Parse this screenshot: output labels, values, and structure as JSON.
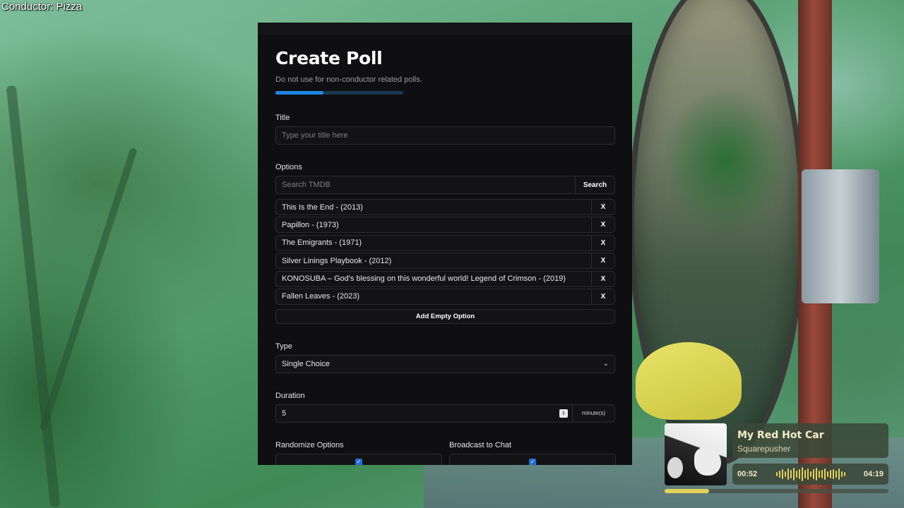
{
  "overlay": {
    "conductor_label": "Conductor: Pizza"
  },
  "poll": {
    "title": "Create Poll",
    "subtitle": "Do not use for non-conductor related polls.",
    "progress_fraction": 0.376,
    "title_field": {
      "label": "Title",
      "placeholder": "Type your title here",
      "value": ""
    },
    "options_section": {
      "label": "Options",
      "search_placeholder": "Search TMDB",
      "search_button": "Search",
      "items": [
        {
          "name": "This Is the End - (2013)",
          "remove": "X"
        },
        {
          "name": "Papillon - (1973)",
          "remove": "X"
        },
        {
          "name": "The Emigrants - (1971)",
          "remove": "X"
        },
        {
          "name": "Silver Linings Playbook - (2012)",
          "remove": "X"
        },
        {
          "name": "KONOSUBA – God's blessing on this wonderful world! Legend of Crimson - (2019)",
          "remove": "X"
        },
        {
          "name": "Fallen Leaves - (2023)",
          "remove": "X"
        }
      ],
      "add_empty_button": "Add Empty Option"
    },
    "type_field": {
      "label": "Type",
      "selected": "Single Choice"
    },
    "duration_field": {
      "label": "Duration",
      "value": "5",
      "unit": "minute(s)"
    },
    "randomize": {
      "label": "Randomize Options",
      "checked": true
    },
    "broadcast": {
      "label": "Broadcast to Chat",
      "checked": true
    },
    "accent_color": "#1e88e5"
  },
  "music": {
    "song": "My Red Hot Car",
    "artist": "Squarepusher",
    "elapsed": "00:52",
    "total": "04:19",
    "progress_fraction": 0.2,
    "accent_color": "#e3d25a"
  }
}
